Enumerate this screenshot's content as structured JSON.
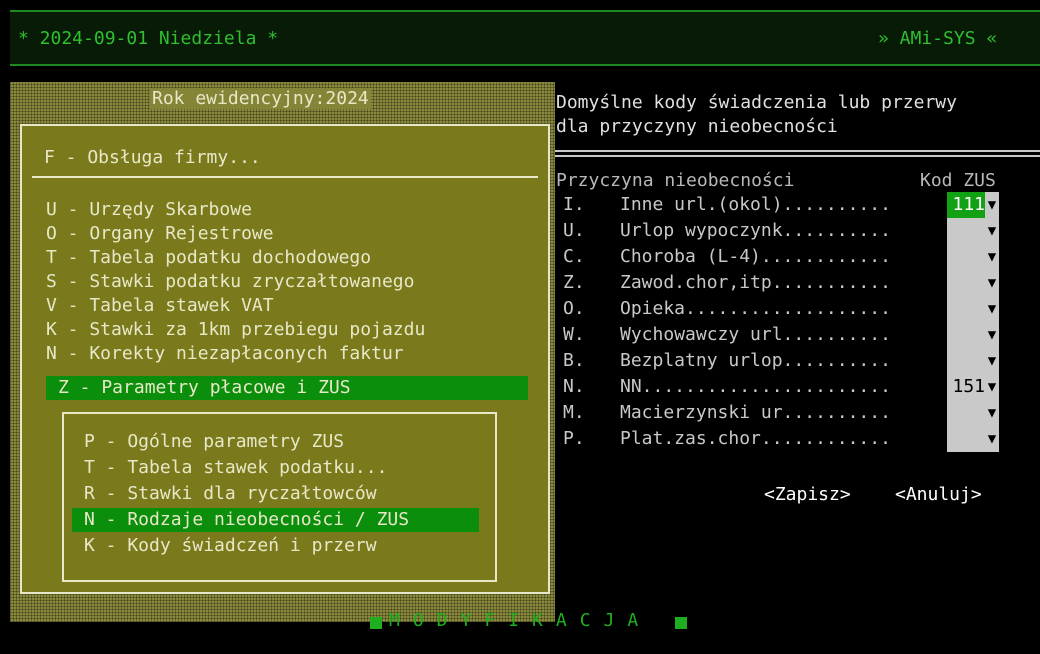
{
  "header": {
    "title": "* 2024-09-01 Niedziela *",
    "brand": "» AMi-SYS «"
  },
  "year_label": "Rok ewidencyjny:2024",
  "main_menu": {
    "title": "F - Obsługa firmy...",
    "items": [
      "U - Urzędy Skarbowe",
      "O - Organy Rejestrowe",
      "T - Tabela podatku dochodowego",
      "S - Stawki podatku zryczałtowanego",
      "V - Tabela stawek VAT",
      "K - Stawki za 1km przebiegu pojazdu",
      "N - Korekty niezapłaconych faktur",
      "Z - Parametry płacowe i ZUS"
    ],
    "active_index": 7
  },
  "sub_menu": {
    "items": [
      "P - Ogólne parametry ZUS",
      "T - Tabela stawek podatku...",
      "R - Stawki dla ryczałtowców",
      "N - Rodzaje nieobecności / ZUS",
      "K - Kody świadczeń i przerw"
    ],
    "active_index": 3
  },
  "dialog": {
    "desc_line1": "Domyślne kody świadczenia lub przerwy",
    "desc_line2": "dla przyczyny nieobecności",
    "col_reason": "Przyczyna nieobecności",
    "col_code": "Kod ZUS",
    "rows": [
      {
        "key": "I.",
        "reason": "Inne url.(okol)..........",
        "code": "111"
      },
      {
        "key": "U.",
        "reason": "Urlop wypoczynk..........",
        "code": ""
      },
      {
        "key": "C.",
        "reason": "Choroba (L-4)............",
        "code": ""
      },
      {
        "key": "Z.",
        "reason": "Zawod.chor,itp...........",
        "code": ""
      },
      {
        "key": "O.",
        "reason": "Opieka...................",
        "code": ""
      },
      {
        "key": "W.",
        "reason": "Wychowawczy url..........",
        "code": ""
      },
      {
        "key": "B.",
        "reason": "Bezplatny urlop..........",
        "code": ""
      },
      {
        "key": "N.",
        "reason": "NN.......................",
        "code": "151"
      },
      {
        "key": "M.",
        "reason": "Macierzynski ur..........",
        "code": ""
      },
      {
        "key": "P.",
        "reason": "Plat.zas.chor............",
        "code": ""
      }
    ],
    "dropdown_glyph": "▼",
    "save_label": "<Zapisz>",
    "cancel_label": "<Anuluj>"
  },
  "status": "MODYFIKACJA"
}
